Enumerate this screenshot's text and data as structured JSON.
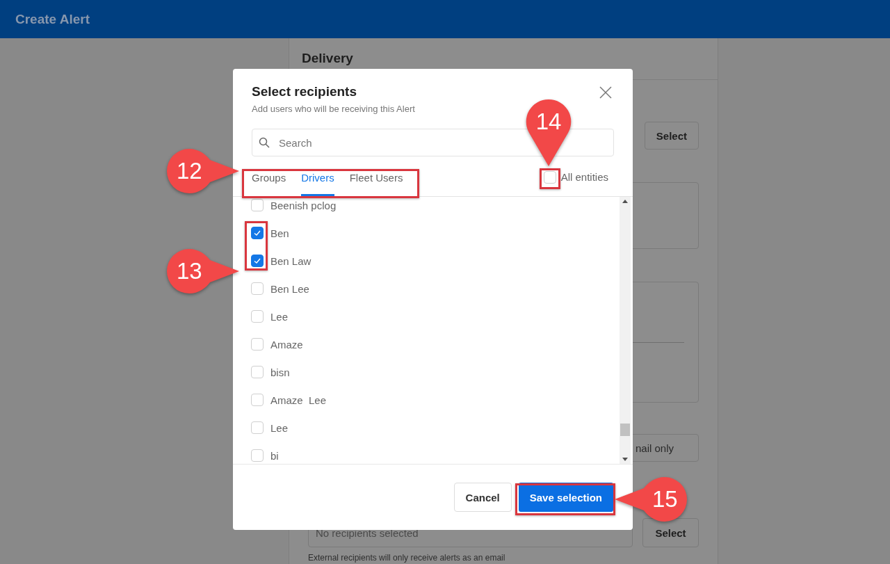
{
  "app_bar": {
    "title": "Create Alert"
  },
  "form": {
    "section_title": "Delivery",
    "recipients_select_button": "Select",
    "delivery_field_value": "nail only",
    "external_field": {
      "placeholder": "No recipients selected"
    },
    "external_select_button": "Select",
    "external_hint": "External recipients will only receive alerts as an email"
  },
  "dialog": {
    "title": "Select recipients",
    "subtitle": "Add users who will be receiving this Alert",
    "search": {
      "placeholder": "Search"
    },
    "tabs": [
      {
        "label": "Groups",
        "selected": false
      },
      {
        "label": "Drivers",
        "selected": true
      },
      {
        "label": "Fleet Users",
        "selected": false
      }
    ],
    "all_entities": {
      "label": "All entities",
      "checked": false
    },
    "recipients": [
      {
        "name": "Beenish pclog",
        "checked": false
      },
      {
        "name": "Ben",
        "checked": true
      },
      {
        "name": "Ben Law",
        "checked": true
      },
      {
        "name": "Ben Lee",
        "checked": false
      },
      {
        "name": "Lee",
        "checked": false
      },
      {
        "name": "Amaze",
        "checked": false
      },
      {
        "name": "bisn",
        "checked": false
      },
      {
        "name": "Amaze  Lee",
        "checked": false
      },
      {
        "name": "Lee",
        "checked": false
      },
      {
        "name": "bi",
        "checked": false
      }
    ],
    "buttons": {
      "cancel": "Cancel",
      "save": "Save selection"
    }
  },
  "callouts": [
    {
      "number": "12"
    },
    {
      "number": "13"
    },
    {
      "number": "14"
    },
    {
      "number": "15"
    }
  ]
}
